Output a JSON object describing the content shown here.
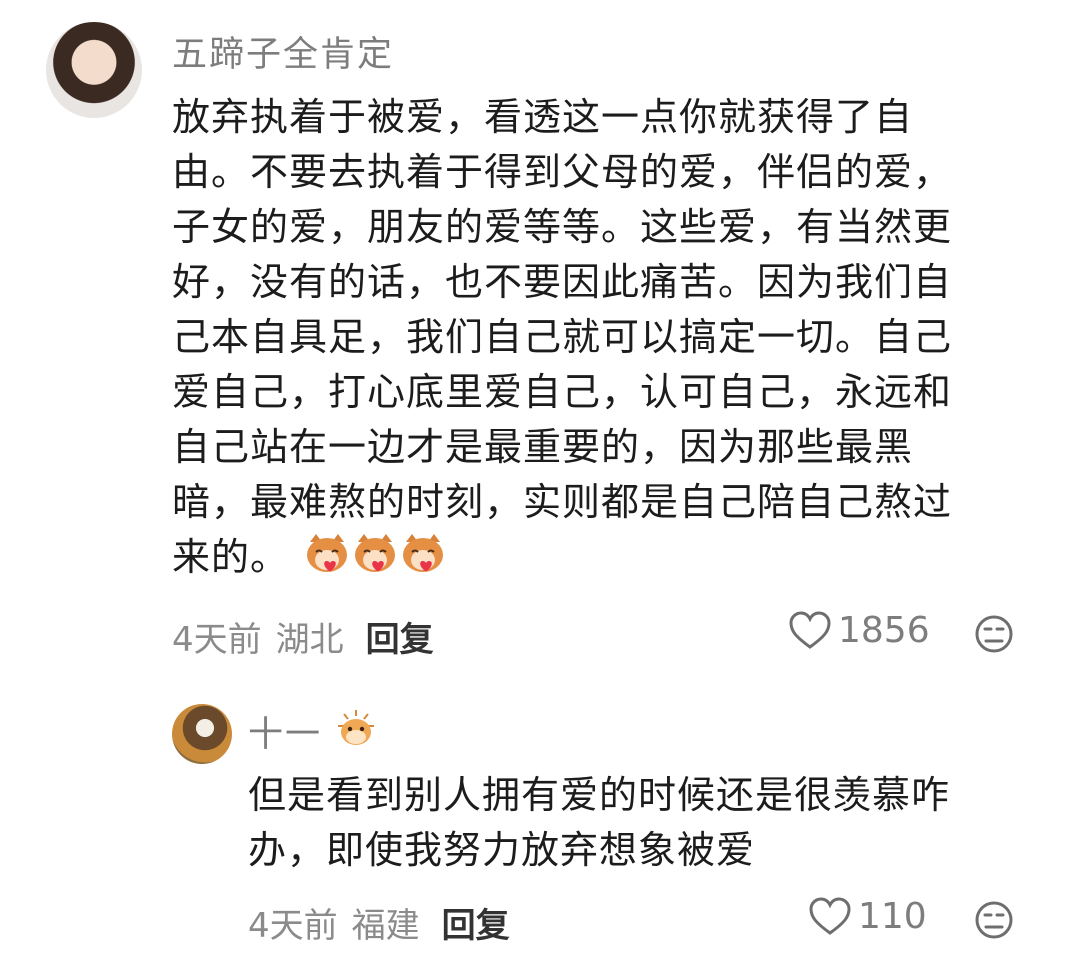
{
  "comment": {
    "username": "五蹄子全肯定",
    "lines": [
      "放弃执着于被爱，看透这一点你就获得了自",
      "由。不要去执着于得到父母的爱，伴侣的爱，",
      "子女的爱，朋友的爱等等。这些爱，有当然更",
      "好，没有的话，也不要因此痛苦。因为我们自",
      "己本自具足，我们自己就可以搞定一切。自己",
      "爱自己，打心底里爱自己，认可自己，永远和",
      "自己站在一边才是最重要的，因为那些最黑",
      "暗，最难熬的时刻，实则都是自己陪自己熬过",
      "来的。"
    ],
    "emojis": [
      "cat-heart-emoji",
      "cat-heart-emoji",
      "cat-heart-emoji"
    ],
    "time": "4天前",
    "location": "湖北",
    "reply_label": "回复",
    "like_count": "1856"
  },
  "reply": {
    "username": "十一",
    "lines": [
      "但是看到别人拥有爱的时候还是很羡慕咋",
      "办，即使我努力放弃想象被爱"
    ],
    "time": "4天前",
    "location": "福建",
    "reply_label": "回复",
    "like_count": "110"
  },
  "icons": {
    "like": "heart-outline-icon",
    "dislike": "sad-face-icon",
    "badge": "pufferfish-badge-icon"
  },
  "colors": {
    "username": "#7d7d7d",
    "text": "#1c1c1c",
    "meta": "#8b8b8b"
  }
}
